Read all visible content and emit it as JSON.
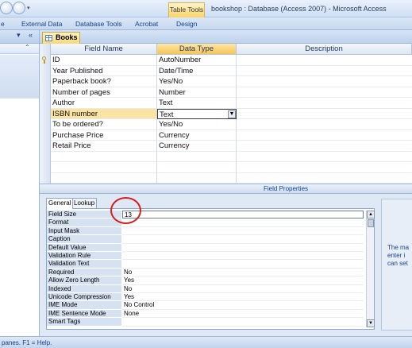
{
  "window": {
    "context_tab": "Table Tools",
    "title": "bookshop : Database (Access 2007) - Microsoft Access"
  },
  "ribbon": {
    "tabs": [
      {
        "label": "e"
      },
      {
        "label": "External Data"
      },
      {
        "label": "Database Tools"
      },
      {
        "label": "Acrobat"
      },
      {
        "label": "Design"
      }
    ]
  },
  "nav": {
    "collapse_glyph": "«",
    "menu_glyph": "▾",
    "up_glyph": "⌃"
  },
  "document": {
    "tab_label": "Books",
    "icon": "table-icon"
  },
  "grid": {
    "headers": {
      "field_name": "Field Name",
      "data_type": "Data Type",
      "description": "Description"
    },
    "rows": [
      {
        "name": "ID",
        "type": "AutoNumber",
        "primary_key": true
      },
      {
        "name": "Year Published",
        "type": "Date/Time"
      },
      {
        "name": "Paperback book?",
        "type": "Yes/No"
      },
      {
        "name": "Number of pages",
        "type": "Number"
      },
      {
        "name": "Author",
        "type": "Text"
      },
      {
        "name": "ISBN number",
        "type": "Text",
        "active": true
      },
      {
        "name": "To be ordered?",
        "type": "Yes/No"
      },
      {
        "name": "Purchase Price",
        "type": "Currency"
      },
      {
        "name": "Retail Price",
        "type": "Currency"
      }
    ]
  },
  "field_properties": {
    "bar_title": "Field Properties",
    "tabs": {
      "general": "General",
      "lookup": "Lookup"
    },
    "properties": [
      {
        "label": "Field Size",
        "value": "13"
      },
      {
        "label": "Format",
        "value": ""
      },
      {
        "label": "Input Mask",
        "value": ""
      },
      {
        "label": "Caption",
        "value": ""
      },
      {
        "label": "Default Value",
        "value": ""
      },
      {
        "label": "Validation Rule",
        "value": ""
      },
      {
        "label": "Validation Text",
        "value": ""
      },
      {
        "label": "Required",
        "value": "No"
      },
      {
        "label": "Allow Zero Length",
        "value": "Yes"
      },
      {
        "label": "Indexed",
        "value": "No"
      },
      {
        "label": "Unicode Compression",
        "value": "Yes"
      },
      {
        "label": "IME Mode",
        "value": "No Control"
      },
      {
        "label": "IME Sentence Mode",
        "value": "None"
      },
      {
        "label": "Smart Tags",
        "value": ""
      }
    ],
    "help_text": "The ma\nenter i\ncan set"
  },
  "status": {
    "text": "panes.  F1 = Help."
  },
  "colors": {
    "accent": "#f6c556",
    "ribbon_text": "#15428b",
    "annotation": "#d31d1d"
  }
}
